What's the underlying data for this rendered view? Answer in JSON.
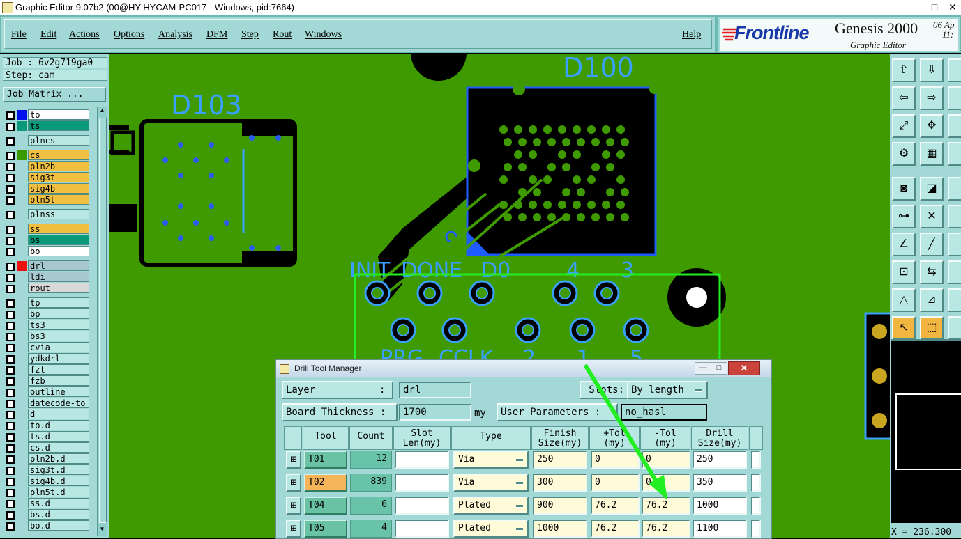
{
  "window": {
    "title": "Graphic Editor 9.07b2 (00@HY-HYCAM-PC017 - Windows, pid:7664)",
    "buttons": [
      "—",
      "□",
      "✕"
    ]
  },
  "menu": {
    "items": [
      "File",
      "Edit",
      "Actions",
      "Options",
      "Analysis",
      "DFM",
      "Step",
      "Rout",
      "Windows"
    ],
    "help": "Help"
  },
  "logo": {
    "brand": "Frontline",
    "product": "Genesis 2000",
    "subtitle": "Graphic Editor",
    "date": "06 Ap",
    "time": "11:"
  },
  "left": {
    "job": "Job : 6v2g719ga0",
    "step": "Step: cam",
    "job_matrix": "Job Matrix ...",
    "layers": [
      {
        "name": "to",
        "swatch": "#0011ee",
        "bg": "#ffffff"
      },
      {
        "name": "ts",
        "swatch": "#0a9a7a",
        "bg": "#0a9a7a"
      },
      {
        "name": "plncs",
        "swatch": "",
        "bg": "#b8e7e4"
      },
      {
        "name": "cs",
        "swatch": "#3a9a00",
        "bg": "#f2c040"
      },
      {
        "name": "pln2b",
        "swatch": "",
        "bg": "#f2c040"
      },
      {
        "name": "sig3t",
        "swatch": "",
        "bg": "#f2c040"
      },
      {
        "name": "sig4b",
        "swatch": "",
        "bg": "#f2c040"
      },
      {
        "name": "pln5t",
        "swatch": "",
        "bg": "#f2c040"
      },
      {
        "name": "plnss",
        "swatch": "",
        "bg": "#b8e7e4"
      },
      {
        "name": "ss",
        "swatch": "",
        "bg": "#f2c040"
      },
      {
        "name": "bs",
        "swatch": "",
        "bg": "#0a9a7a"
      },
      {
        "name": "bo",
        "swatch": "",
        "bg": "#ffffff"
      },
      {
        "name": "drl",
        "swatch": "#ee1111",
        "bg": "#a8c8d0"
      },
      {
        "name": "ldi",
        "swatch": "",
        "bg": "#a8c8d0"
      },
      {
        "name": "rout",
        "swatch": "",
        "bg": "#d8d8d8"
      },
      {
        "name": "tp",
        "swatch": "",
        "bg": "#b8e7e4"
      },
      {
        "name": "bp",
        "swatch": "",
        "bg": "#b8e7e4"
      },
      {
        "name": "ts3",
        "swatch": "",
        "bg": "#b8e7e4"
      },
      {
        "name": "bs3",
        "swatch": "",
        "bg": "#b8e7e4"
      },
      {
        "name": "cvia",
        "swatch": "",
        "bg": "#b8e7e4"
      },
      {
        "name": "ydkdrl",
        "swatch": "",
        "bg": "#b8e7e4"
      },
      {
        "name": "fzt",
        "swatch": "",
        "bg": "#b8e7e4"
      },
      {
        "name": "fzb",
        "swatch": "",
        "bg": "#b8e7e4"
      },
      {
        "name": "outline",
        "swatch": "",
        "bg": "#b8e7e4"
      },
      {
        "name": "datecode-to",
        "swatch": "",
        "bg": "#b8e7e4"
      },
      {
        "name": "d",
        "swatch": "",
        "bg": "#b8e7e4"
      },
      {
        "name": "to.d",
        "swatch": "",
        "bg": "#b8e7e4"
      },
      {
        "name": "ts.d",
        "swatch": "",
        "bg": "#b8e7e4"
      },
      {
        "name": "cs.d",
        "swatch": "",
        "bg": "#b8e7e4"
      },
      {
        "name": "pln2b.d",
        "swatch": "",
        "bg": "#b8e7e4"
      },
      {
        "name": "sig3t.d",
        "swatch": "",
        "bg": "#b8e7e4"
      },
      {
        "name": "sig4b.d",
        "swatch": "",
        "bg": "#b8e7e4"
      },
      {
        "name": "pln5t.d",
        "swatch": "",
        "bg": "#b8e7e4"
      },
      {
        "name": "ss.d",
        "swatch": "",
        "bg": "#b8e7e4"
      },
      {
        "name": "bs.d",
        "swatch": "",
        "bg": "#b8e7e4"
      },
      {
        "name": "bo.d",
        "swatch": "",
        "bg": "#b8e7e4"
      }
    ]
  },
  "canvas": {
    "refdes_d100": "D100",
    "refdes_d103": "D103",
    "silk_top": [
      "INIT",
      "DONE",
      "D0",
      "4",
      "3"
    ],
    "silk_bottom": [
      "PRG",
      "CCLK",
      "2",
      "1",
      "5"
    ]
  },
  "coordinates": "X = 236.300",
  "dialog": {
    "title": "Drill Tool Manager",
    "layer_label": "Layer",
    "layer_colon": ":",
    "layer_value": "drl",
    "slots_label": "Slots:",
    "slots_value": "By length",
    "board_thickness_label": "Board Thickness :",
    "board_thickness_value": "1700",
    "board_thickness_unit": "my",
    "user_params_label": "User Parameters :",
    "user_params_value": "no_hasl",
    "columns": [
      "Tool",
      "Count",
      "Slot Len(my)",
      "Type",
      "Finish Size(my)",
      "+Tol (my)",
      "-Tol (my)",
      "Drill Size(my)"
    ],
    "rows": [
      {
        "tool": "T01",
        "count": "12",
        "slot": "",
        "type": "Via",
        "finish": "250",
        "ptol": "0",
        "mtol": "0",
        "drill": "250",
        "highlight": false
      },
      {
        "tool": "T02",
        "count": "839",
        "slot": "",
        "type": "Via",
        "finish": "300",
        "ptol": "0",
        "mtol": "0",
        "drill": "350",
        "highlight": true
      },
      {
        "tool": "T04",
        "count": "6",
        "slot": "",
        "type": "Plated",
        "finish": "900",
        "ptol": "76.2",
        "mtol": "76.2",
        "drill": "1000",
        "highlight": false
      },
      {
        "tool": "T05",
        "count": "4",
        "slot": "",
        "type": "Plated",
        "finish": "1000",
        "ptol": "76.2",
        "mtol": "76.2",
        "drill": "1100",
        "highlight": false
      }
    ]
  },
  "colors": {
    "panel": "#a2d9d6",
    "board": "#3f9a00",
    "highlight_tool": "#f6b55a",
    "annotation_arrow": "#22ee22"
  }
}
